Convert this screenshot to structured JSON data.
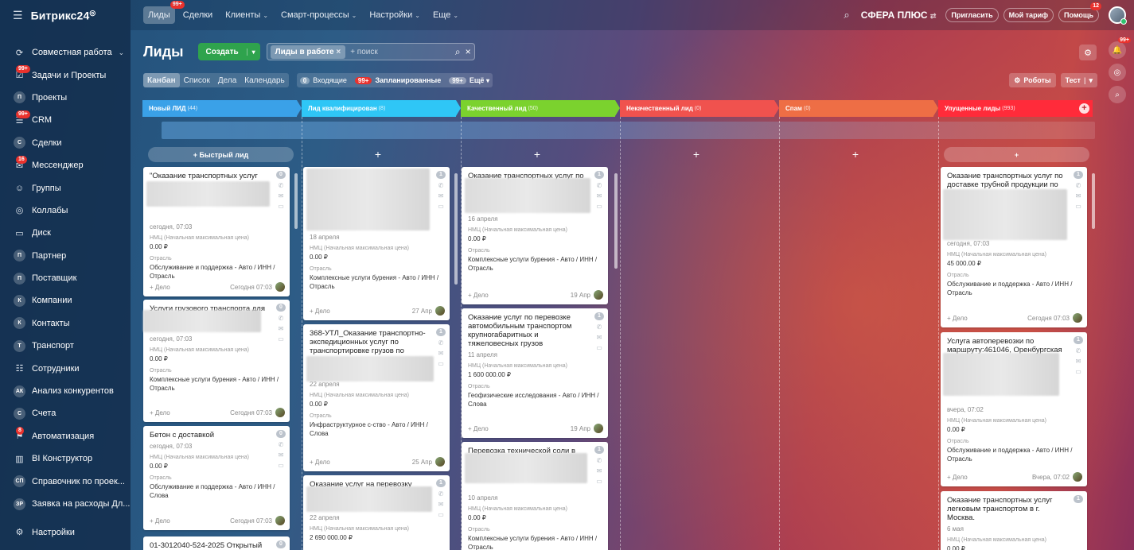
{
  "brand": "Битрикс24",
  "sidebar": {
    "items": [
      {
        "label": "Совместная работа",
        "icon": "collab-icon",
        "arrow": true
      },
      {
        "label": "Задачи и Проекты",
        "icon": "tasks-icon",
        "badge": "99+"
      },
      {
        "label": "Проекты",
        "icon": "П"
      },
      {
        "label": "CRM",
        "icon": "crm-icon",
        "badge": "99+"
      },
      {
        "label": "Сделки",
        "icon": "С"
      },
      {
        "label": "Мессенджер",
        "icon": "messenger-icon",
        "badge": "16"
      },
      {
        "label": "Группы",
        "icon": "groups-icon"
      },
      {
        "label": "Коллабы",
        "icon": "collabs-icon"
      },
      {
        "label": "Диск",
        "icon": "disk-icon"
      },
      {
        "label": "Партнер",
        "icon": "П"
      },
      {
        "label": "Поставщик",
        "icon": "П"
      },
      {
        "label": "Компании",
        "icon": "К"
      },
      {
        "label": "Контакты",
        "icon": "К"
      },
      {
        "label": "Транспорт",
        "icon": "Т"
      },
      {
        "label": "Сотрудники",
        "icon": "employees-icon"
      },
      {
        "label": "Анализ конкурентов",
        "icon": "АК"
      },
      {
        "label": "Счета",
        "icon": "С"
      },
      {
        "label": "Автоматизация",
        "icon": "automation-icon",
        "badge": "8"
      },
      {
        "label": "BI Конструктор",
        "icon": "bi-icon"
      },
      {
        "label": "Справочник по проек...",
        "icon": "СП"
      },
      {
        "label": "Заявка на расходы Дл...",
        "icon": "ЗР"
      }
    ],
    "settings": "Настройки"
  },
  "topnav": {
    "items": [
      {
        "label": "Лиды",
        "badge": "99+",
        "active": true
      },
      {
        "label": "Сделки"
      },
      {
        "label": "Клиенты",
        "caret": true
      },
      {
        "label": "Смарт-процессы",
        "caret": true
      },
      {
        "label": "Настройки",
        "caret": true
      },
      {
        "label": "Еще",
        "caret": true
      }
    ],
    "company": "СФЕРА ПЛЮС",
    "invite": "Пригласить",
    "tariff": "Мой тариф",
    "help": "Помощь",
    "help_badge": "12"
  },
  "page": {
    "title": "Лиды",
    "create": "Создать",
    "filter_chip": "Лиды в работе",
    "search_placeholder": "+ поиск"
  },
  "views": {
    "tabs": [
      "Канбан",
      "Список",
      "Дела",
      "Календарь"
    ],
    "incoming_count": "0",
    "incoming": "Входящие",
    "planned_count": "99+",
    "planned": "Запланированные",
    "more_count": "99+",
    "more": "Ещё"
  },
  "right_buttons": {
    "robots": "Роботы",
    "test": "Тест"
  },
  "rside_badge": "99+",
  "quick_add": "+ Быстрый лид",
  "plus": "+",
  "columns": [
    {
      "name": "Новый ЛИД",
      "count": "(44)",
      "color": "#3aa1e8"
    },
    {
      "name": "Лид квалифицирован",
      "count": "(8)",
      "color": "#2fc6f6"
    },
    {
      "name": "Качественный лид",
      "count": "(50)",
      "color": "#7bd22e"
    },
    {
      "name": "Некачественный лид",
      "count": "(0)",
      "color": "#f0524e"
    },
    {
      "name": "Спам",
      "count": "(0)",
      "color": "#ee6e45"
    },
    {
      "name": "Упущенные лиды",
      "count": "(993)",
      "color": "#ff2b3a"
    }
  ],
  "cards": [
    {
      "title": "\"Оказание транспортных услуг технологическим транспортом для",
      "date": "сегодня, 07:03",
      "price_label": "НМЦ (Начальная максимальная цена)",
      "price": "0.00 ₽",
      "industry_label": "Отрасль",
      "industry": "Обслуживание и поддержка - Авто / ИНН / Отрасль",
      "add": "+ Дело",
      "footer_date": "Сегодня 07:03",
      "count": "0"
    },
    {
      "title": "Услуги грузового транспорта для",
      "date": "сегодня, 07:03",
      "price_label": "НМЦ (Начальная максимальная цена)",
      "price": "0.00 ₽",
      "industry_label": "Отрасль",
      "industry": "Комплексные услуги бурения - Авто / ИНН / Отрасль",
      "add": "+ Дело",
      "footer_date": "Сегодня 07:03",
      "count": "0"
    },
    {
      "title": "Бетон с доставкой",
      "date": "сегодня, 07:03",
      "price_label": "НМЦ (Начальная максимальная цена)",
      "price": "0.00 ₽",
      "industry_label": "Отрасль",
      "industry": "Обслуживание и поддержка - Авто / ИНН / Слова",
      "add": "+ Дело",
      "footer_date": "Сегодня 07:03",
      "count": "0"
    },
    {
      "title": "01-3012040-524-2025 Открытый",
      "count": "0"
    },
    {
      "title": "",
      "date": "18 апреля",
      "price_label": "НМЦ (Начальная максимальная цена)",
      "price": "0.00 ₽",
      "industry_label": "Отрасль",
      "industry": "Комплексные услуги бурения - Авто / ИНН / Отрасль",
      "add": "+ Дело",
      "footer_date": "27 Апр",
      "count": "1"
    },
    {
      "title": "368-УТЛ_Оказание транспортно-экспедиционных услуг по транспортировке грузов по",
      "date": "22 апреля",
      "price_label": "НМЦ (Начальная максимальная цена)",
      "price": "0.00 ₽",
      "industry_label": "Отрасль",
      "industry": "Инфраструктурное с-ство - Авто / ИНН / Слова",
      "add": "+ Дело",
      "footer_date": "25 Апр",
      "count": "1"
    },
    {
      "title": "Оказание услуг на перевозку",
      "date": "22 апреля",
      "price_label": "НМЦ (Начальная максимальная цена)",
      "price": "2 690 000.00 ₽",
      "count": "1"
    },
    {
      "title": "Оказание транспортных услуг по",
      "date": "16 апреля",
      "price_label": "НМЦ (Начальная максимальная цена)",
      "price": "0.00 ₽",
      "industry_label": "Отрасль",
      "industry": "Комплексные услуги бурения - Авто / ИНН / Отрасль",
      "add": "+ Дело",
      "footer_date": "19 Апр",
      "count": "1"
    },
    {
      "title": "Оказание услуг по перевозке автомобильным транспортом крупногабаритных и тяжеловесных грузов",
      "date": "11 апреля",
      "price_label": "НМЦ (Начальная максимальная цена)",
      "price": "1 600 000.00 ₽",
      "industry_label": "Отрасль",
      "industry": "Геофизические исследования - Авто / ИНН / Слова",
      "add": "+ Дело",
      "footer_date": "19 Апр",
      "count": "1"
    },
    {
      "title": "Перевозка технической соли в биг-",
      "date": "10 апреля",
      "price_label": "НМЦ (Начальная максимальная цена)",
      "price": "0.00 ₽",
      "industry_label": "Отрасль",
      "industry": "Комплексные услуги бурения - Авто / ИНН / Отрасль",
      "count": "1"
    },
    {
      "title": "Оказание транспортных услуг по доставке трубной продукции по",
      "date": "сегодня, 07:03",
      "price_label": "НМЦ (Начальная максимальная цена)",
      "price": "45 000.00 ₽",
      "industry_label": "Отрасль",
      "industry": "Обслуживание и поддержка - Авто / ИНН / Отрасль",
      "add": "+ Дело",
      "footer_date": "Сегодня 07:03",
      "count": "1"
    },
    {
      "title": "Услуга автоперевозки по маршруту:461046, Оренбургская обл.",
      "date": "вчера, 07:02",
      "price_label": "НМЦ (Начальная максимальная цена)",
      "price": "0.00 ₽",
      "industry_label": "Отрасль",
      "industry": "Обслуживание и поддержка - Авто / ИНН / Отрасль",
      "add": "+ Дело",
      "footer_date": "Вчера, 07:02",
      "count": "1"
    },
    {
      "title": "Оказание транспортных услуг легковым транспортом в г. Москва.",
      "date": "6 мая",
      "price_label": "НМЦ (Начальная максимальная цена)",
      "price": "0.00 ₽",
      "count": "1"
    }
  ]
}
